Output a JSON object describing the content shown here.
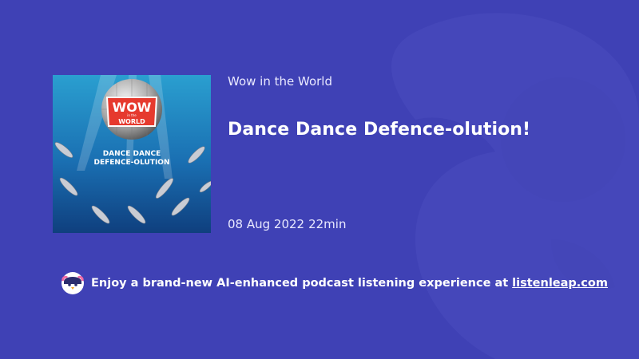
{
  "podcast": {
    "name": "Wow in the World",
    "cover_text": {
      "logo_line1": "WOW",
      "logo_line2": "in the",
      "logo_line3": "WORLD",
      "episode_line1": "DANCE DANCE",
      "episode_line2": "DEFENCE-OLUTION"
    }
  },
  "episode": {
    "title": "Dance Dance Defence-olution!",
    "date": "08 Aug 2022",
    "duration": "22min"
  },
  "footer": {
    "promo_text": "Enjoy a brand-new AI-enhanced podcast listening experience at",
    "link_text": "listenleap.com",
    "avatar_icon": "penguin-icon"
  },
  "colors": {
    "background": "#3f41b5",
    "text": "#ffffff",
    "subtle_text": "#e9e9ff"
  }
}
